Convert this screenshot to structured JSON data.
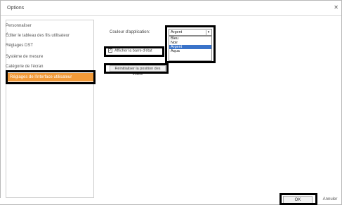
{
  "window": {
    "title": "Options",
    "close_glyph": "✕"
  },
  "sidebar": {
    "items": [
      {
        "label": "Personnaliser"
      },
      {
        "label": "Éditer le tableau des fils utilisateur"
      },
      {
        "label": "Réglages DST"
      },
      {
        "label": "Système de mesure"
      },
      {
        "label": "Catégorie de l'écran"
      },
      {
        "label": "Réglages de l'interface utilisateur",
        "selected": true
      }
    ]
  },
  "content": {
    "color_label": "Couleur d'application:",
    "color_select": {
      "value": "Argent",
      "options": [
        "Bleu",
        "Noir",
        "Argent",
        "Aqua"
      ],
      "highlighted": "Argent"
    },
    "status_bar_checkbox": {
      "checked": true,
      "label": "Afficher la barre d'état"
    },
    "reset_button_label": "Réinitialiser la position des volets"
  },
  "footer": {
    "ok_label": "OK",
    "cancel_label": "Annuler"
  },
  "colors": {
    "selection_accent": "#f29a38",
    "dropdown_highlight": "#3a73c9",
    "annotation": "#000000"
  }
}
